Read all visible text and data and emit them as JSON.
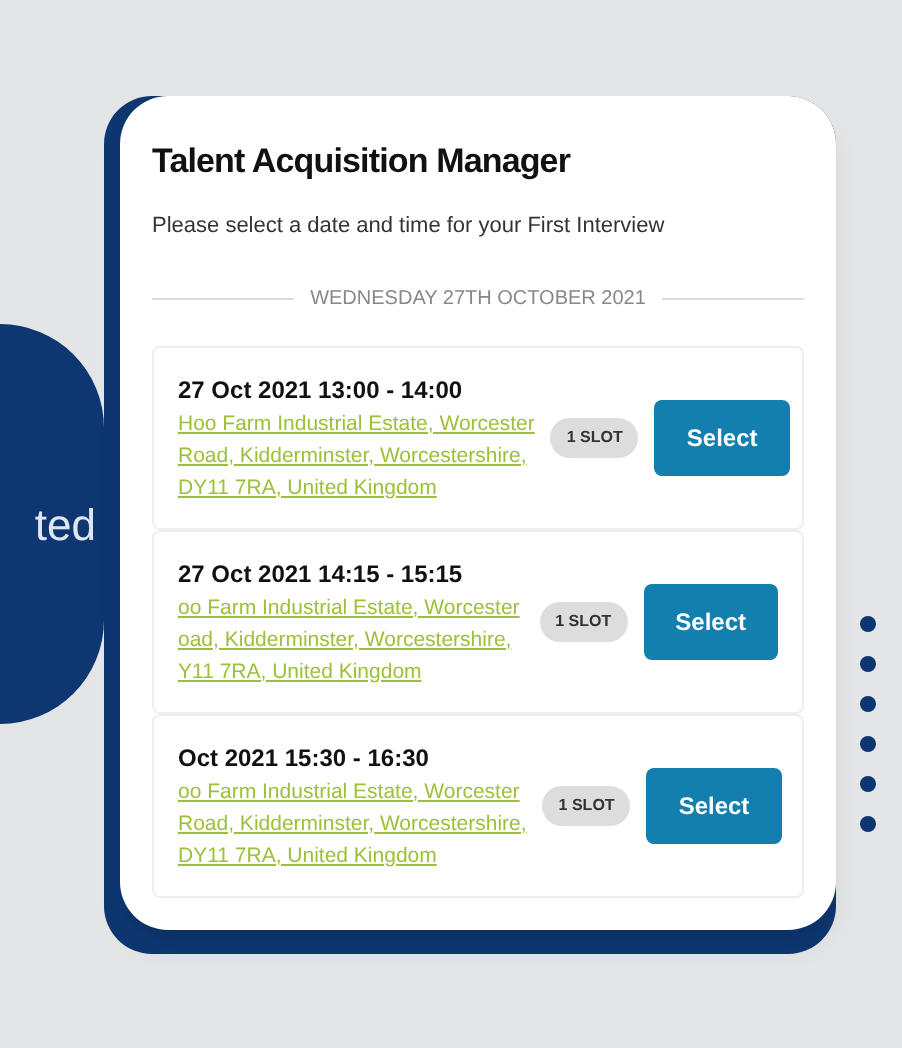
{
  "card": {
    "title": "Talent Acquisition Manager",
    "subtitle": "Please select a date and time for your First Interview",
    "date_heading": "WEDNESDAY 27TH OCTOBER 2021"
  },
  "slots": [
    {
      "time": "27 Oct 2021 13:00 - 14:00",
      "address_lines": [
        "Hoo Farm Industrial Estate, Worcester",
        "Road, Kidderminster, Worcestershire,",
        "DY11 7RA, United Kingdom"
      ],
      "badge": "1 SLOT",
      "button": "Select"
    },
    {
      "time": "27 Oct 2021 14:15 - 15:15",
      "address_lines": [
        "oo Farm Industrial Estate, Worcester",
        "oad, Kidderminster, Worcestershire,",
        "Y11 7RA, United Kingdom"
      ],
      "badge": "1 SLOT",
      "button": "Select"
    },
    {
      "time": "Oct 2021 15:30 - 16:30",
      "address_lines": [
        "oo Farm Industrial Estate, Worcester",
        "Road, Kidderminster, Worcestershire,",
        "DY11 7RA, United Kingdom"
      ],
      "badge": "1 SLOT",
      "button": "Select"
    }
  ],
  "circle_text": "ted"
}
